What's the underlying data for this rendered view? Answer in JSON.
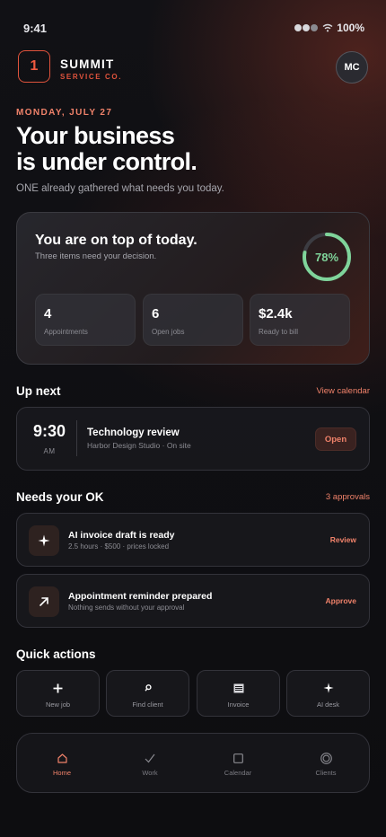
{
  "status_bar": {
    "time": "9:41",
    "battery": "100%"
  },
  "brand": {
    "logo_mark": "1",
    "name": "SUMMIT",
    "sub": "SERVICE CO.",
    "avatar_initials": "MC"
  },
  "greeting": {
    "date": "MONDAY, JULY 27",
    "headline_line1": "Your business",
    "headline_line2": "is under control.",
    "subline": "ONE already gathered what needs you today."
  },
  "summary": {
    "title": "You are on top of today.",
    "subtitle": "Three items need your decision.",
    "progress_label": "78%",
    "progress": 0.78,
    "stats": [
      {
        "value": "4",
        "label": "Appointments"
      },
      {
        "value": "6",
        "label": "Open jobs"
      },
      {
        "value": "$2.4k",
        "label": "Ready to bill"
      }
    ]
  },
  "up_next": {
    "title": "Up next",
    "link": "View calendar",
    "time": "9:30",
    "ampm": "AM",
    "event_title": "Technology review",
    "event_sub": "Harbor Design Studio · On site",
    "action": "Open"
  },
  "approvals": {
    "title": "Needs your OK",
    "link": "3 approvals",
    "items": [
      {
        "icon": "sparkle-icon",
        "title": "AI invoice draft is ready",
        "sub": "2.5 hours · $500 · prices locked",
        "action": "Review"
      },
      {
        "icon": "arrow-up-right-icon",
        "title": "Appointment reminder prepared",
        "sub": "Nothing sends without your approval",
        "action": "Approve"
      }
    ]
  },
  "quick_actions": {
    "title": "Quick actions",
    "items": [
      {
        "icon": "plus-icon",
        "label": "New job"
      },
      {
        "icon": "search-icon",
        "label": "Find client"
      },
      {
        "icon": "invoice-icon",
        "label": "Invoice"
      },
      {
        "icon": "sparkle-icon",
        "label": "AI desk"
      }
    ]
  },
  "nav": {
    "items": [
      {
        "icon": "home-icon",
        "label": "Home",
        "active": true
      },
      {
        "icon": "check-icon",
        "label": "Work"
      },
      {
        "icon": "square-icon",
        "label": "Calendar"
      },
      {
        "icon": "clients-icon",
        "label": "Clients"
      }
    ]
  },
  "colors": {
    "accent": "#f0826a",
    "brand": "#e0533c",
    "progress": "#7fd49a"
  }
}
